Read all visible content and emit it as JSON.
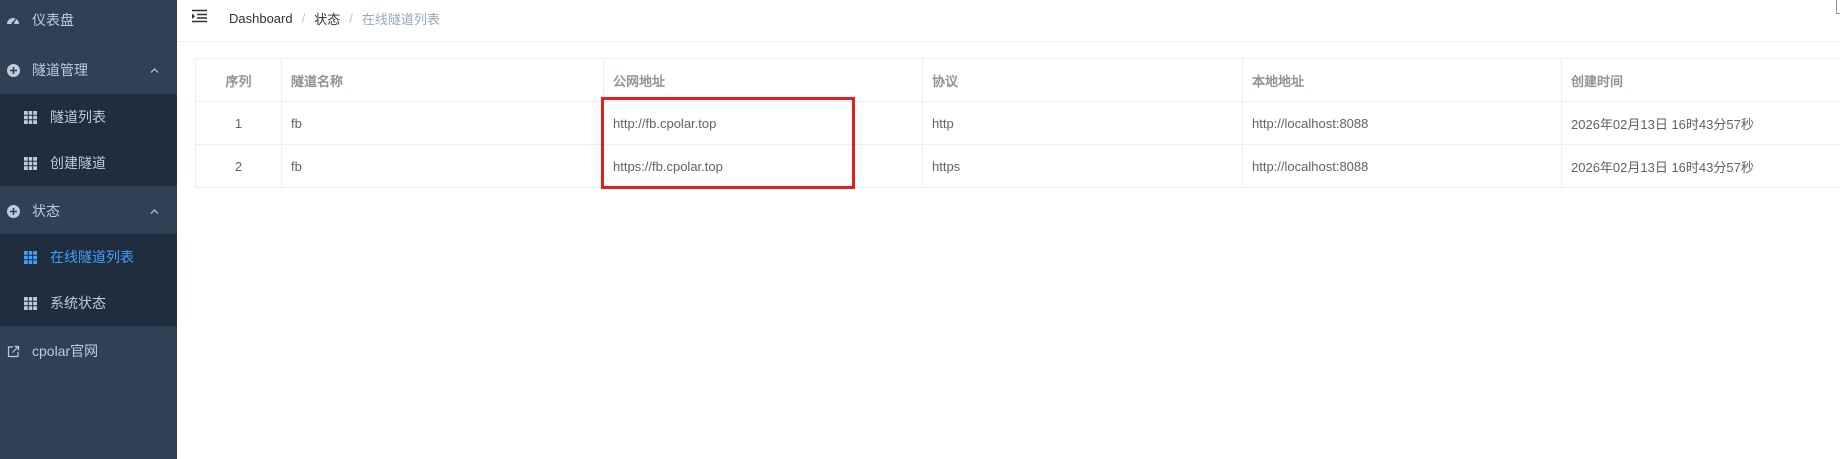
{
  "sidebar": {
    "items": [
      {
        "label": "仪表盘",
        "icon": "dashboard-icon"
      },
      {
        "label": "隧道管理",
        "icon": "circle-plus-icon",
        "expanded": true,
        "children": [
          {
            "label": "隧道列表",
            "icon": "grid-icon"
          },
          {
            "label": "创建隧道",
            "icon": "grid-icon"
          }
        ]
      },
      {
        "label": "状态",
        "icon": "circle-plus-icon",
        "expanded": true,
        "children": [
          {
            "label": "在线隧道列表",
            "icon": "grid-icon",
            "active": true
          },
          {
            "label": "系统状态",
            "icon": "grid-icon"
          }
        ]
      },
      {
        "label": "cpolar官网",
        "icon": "external-link-icon"
      }
    ]
  },
  "navbar": {
    "breadcrumb": [
      "Dashboard",
      "状态",
      "在线隧道列表"
    ]
  },
  "table": {
    "columns": [
      "序列",
      "隧道名称",
      "公网地址",
      "协议",
      "本地地址",
      "创建时间"
    ],
    "rows": [
      [
        "1",
        "fb",
        "http://fb.cpolar.top",
        "http",
        "http://localhost:8088",
        "2026年02月13日 16时43分57秒"
      ],
      [
        "2",
        "fb",
        "https://fb.cpolar.top",
        "https",
        "http://localhost:8088",
        "2026年02月13日 16时43分57秒"
      ]
    ]
  },
  "colors": {
    "sidebar_bg": "#304156",
    "submenu_bg": "#1f2d3d",
    "active": "#409eff",
    "highlight": "#e0201d"
  }
}
